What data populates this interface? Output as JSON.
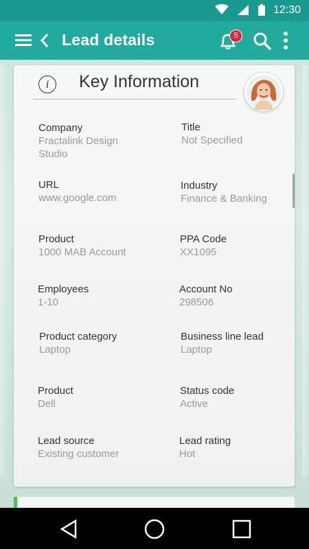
{
  "status_bar": {
    "time": "12:30"
  },
  "app_bar": {
    "title": "Lead details",
    "notification_count": "5"
  },
  "card": {
    "heading": "Key Information",
    "fields": [
      {
        "label": "Company",
        "value": "Fractalink Design Studio"
      },
      {
        "label": "Title",
        "value": "Not Specified"
      },
      {
        "label": "URL",
        "value": "www.google.com"
      },
      {
        "label": "Industry",
        "value": "Finance & Banking"
      },
      {
        "label": "Product",
        "value": "1000 MAB Account"
      },
      {
        "label": "PPA Code",
        "value": "XX1095"
      },
      {
        "label": "Employees",
        "value": "1-10"
      },
      {
        "label": "Account No",
        "value": "298506"
      },
      {
        "label": "Product category",
        "value": "Laptop"
      },
      {
        "label": "Business line lead",
        "value": "Laptop"
      },
      {
        "label": "Product",
        "value": "Dell"
      },
      {
        "label": "Status code",
        "value": "Active"
      },
      {
        "label": "Lead source",
        "value": "Existing customer"
      },
      {
        "label": "Lead rating",
        "value": "Hot"
      }
    ]
  },
  "colors": {
    "status_bar": "#1a9a8f",
    "app_bar": "#22aa9d",
    "badge": "#d9263f",
    "accent_green": "#4fc14a"
  },
  "icons": [
    "wifi-icon",
    "signal-icon",
    "battery-icon",
    "menu-icon",
    "back-arrow-icon",
    "bell-icon",
    "search-icon",
    "more-vert-icon",
    "info-icon",
    "nav-back-icon",
    "nav-home-icon",
    "nav-recent-icon"
  ]
}
